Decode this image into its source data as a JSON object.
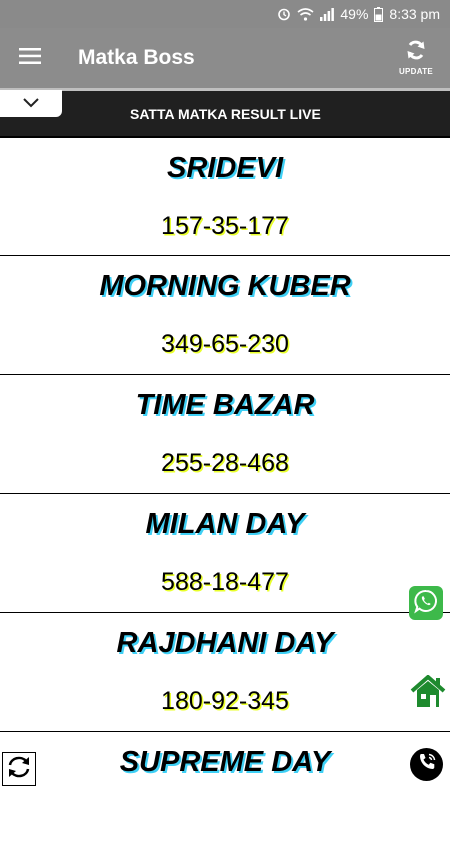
{
  "status_bar": {
    "battery": "49%",
    "time": "8:33 pm"
  },
  "app_bar": {
    "title": "Matka Boss",
    "update_label": "UPDATE"
  },
  "ticker": {
    "text": "SATTA MATKA RESULT LIVE"
  },
  "markets": [
    {
      "name": "SRIDEVI",
      "result": "157-35-177"
    },
    {
      "name": "MORNING KUBER",
      "result": "349-65-230"
    },
    {
      "name": "TIME BAZAR",
      "result": "255-28-468"
    },
    {
      "name": "MILAN DAY",
      "result": "588-18-477"
    },
    {
      "name": "RAJDHANI DAY",
      "result": "180-92-345"
    },
    {
      "name": "SUPREME DAY",
      "result": ""
    }
  ],
  "icons": {
    "alarm": "alarm-icon",
    "wifi": "wifi-icon",
    "signal": "signal-icon",
    "battery": "battery-icon",
    "menu": "hamburger-menu-icon",
    "update": "refresh-icon",
    "collapse": "chevron-down-icon",
    "whatsapp": "whatsapp-icon",
    "home": "home-icon",
    "refresh": "swap-arrows-icon",
    "call": "phone-call-icon"
  },
  "colors": {
    "app_bar": "#8c8c8c",
    "ticker": "#202020",
    "name_shadow": "#3fd0f5",
    "result_shadow": "#e9ff2a",
    "whatsapp_green": "#3db94a",
    "home_green": "#1e8a2e"
  }
}
